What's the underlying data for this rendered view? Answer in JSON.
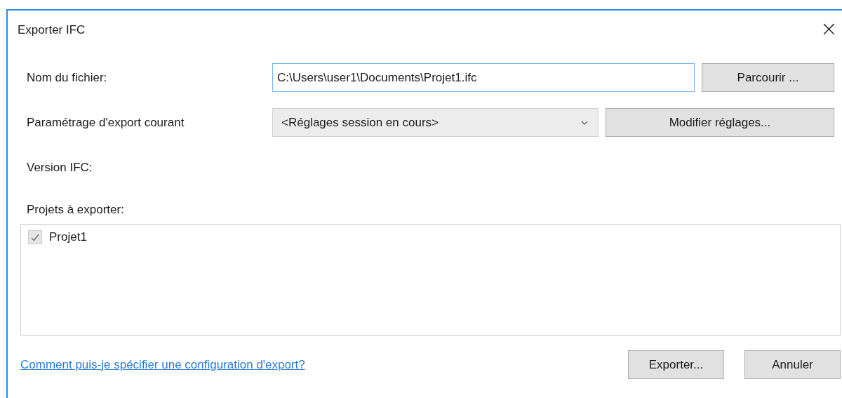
{
  "window": {
    "title": "Exporter IFC",
    "close": "×"
  },
  "file_name": {
    "label": "Nom du fichier:",
    "value": "C:\\Users\\user1\\Documents\\Projet1.ifc",
    "button": "Parcourir ..."
  },
  "export_setup": {
    "label": "Paramétrage d'export courant",
    "value": "<Réglages session en cours>",
    "button": "Modifier réglages..."
  },
  "ifc_version": {
    "label": "Version IFC:"
  },
  "projects": {
    "label": "Projets à exporter:",
    "items": [
      {
        "name": "Projet1",
        "checked": true,
        "disabled": true
      }
    ]
  },
  "help_link": "Comment puis-je spécifier une configuration d'export?",
  "buttons": [
    "Exporter...",
    "Annuler"
  ]
}
